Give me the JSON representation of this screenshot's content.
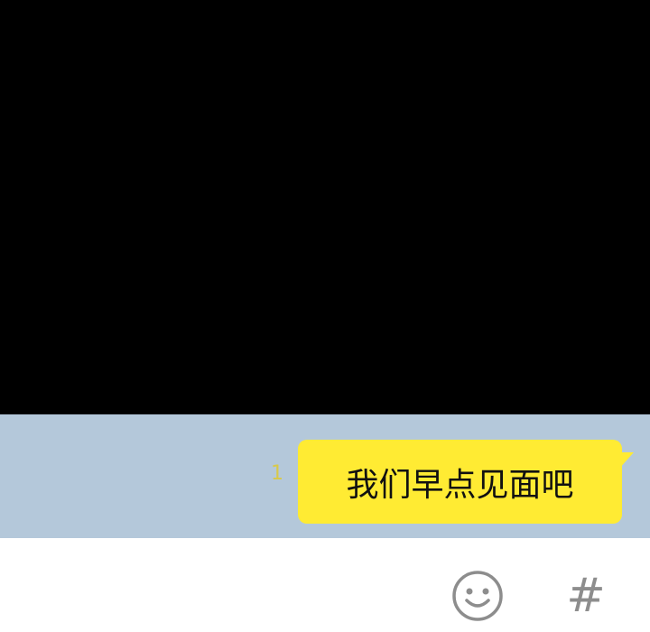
{
  "chat": {
    "unread_count": "1",
    "message_text": "我们早点见面吧"
  },
  "input_bar": {
    "emoji_icon": "smiley-face-icon",
    "hash_label": "#"
  },
  "colors": {
    "chat_background": "#b4c8da",
    "bubble": "#ffeb33",
    "top_panel": "#000000"
  }
}
